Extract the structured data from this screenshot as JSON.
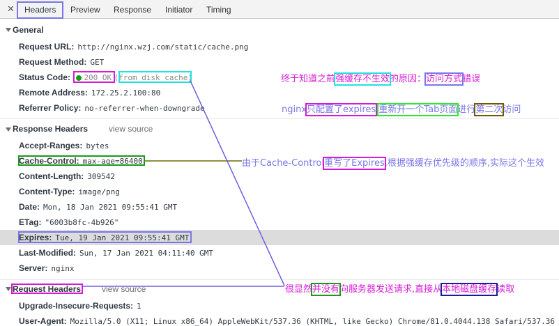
{
  "tabs": {
    "close_glyph": "✕",
    "items": [
      "Headers",
      "Preview",
      "Response",
      "Initiator",
      "Timing"
    ],
    "active": "Headers"
  },
  "general": {
    "title": "General",
    "request_url_key": "Request URL:",
    "request_url": "http://nginx.wzj.com/static/cache.png",
    "request_method_key": "Request Method:",
    "request_method": "GET",
    "status_code_key": "Status Code:",
    "status_code": "200 OK",
    "status_note_open": "(",
    "status_note": "from disk cache",
    "status_note_close": ")",
    "remote_address_key": "Remote Address:",
    "remote_address": "172.25.2.100:80",
    "referrer_policy_key": "Referrer Policy:",
    "referrer_policy": "no-referrer-when-downgrade"
  },
  "response_headers": {
    "title": "Response Headers",
    "view_source": "view source",
    "rows": [
      {
        "key": "Accept-Ranges:",
        "value": "bytes"
      },
      {
        "key": "Cache-Control:",
        "value": "max-age=86400"
      },
      {
        "key": "Content-Length:",
        "value": "309542"
      },
      {
        "key": "Content-Type:",
        "value": "image/png"
      },
      {
        "key": "Date:",
        "value": "Mon, 18 Jan 2021 09:55:41 GMT"
      },
      {
        "key": "ETag:",
        "value": "\"6003b8fc-4b926\""
      },
      {
        "key": "Expires:",
        "value": "Tue, 19 Jan 2021 09:55:41 GMT"
      },
      {
        "key": "Last-Modified:",
        "value": "Sun, 17 Jan 2021 04:11:40 GMT"
      },
      {
        "key": "Server:",
        "value": "nginx"
      }
    ]
  },
  "request_headers": {
    "title": "Request Headers",
    "view_source": "view source",
    "rows": [
      {
        "key": "Upgrade-Insecure-Requests:",
        "value": "1"
      },
      {
        "key": "User-Agent:",
        "value": "Mozilla/5.0 (X11; Linux x86_64) AppleWebKit/537.36 (KHTML, like Gecko) Chrome/81.0.4044.138 Safari/537.36"
      }
    ]
  },
  "annotations": {
    "note1": {
      "a": "终于知道之前",
      "b": "强缓存不生效",
      "c": "的原因：",
      "d": "访问方式",
      "e": "错误"
    },
    "note2": {
      "a": "nginx",
      "b": "只配置了expires",
      "c": ",",
      "d": "重新开一个Tab页面",
      "e": "进行",
      "f": "第二次",
      "g": "访问"
    },
    "note3": {
      "a": "由于Cache-Control",
      "b": "重写了Expires",
      "c": ",根据强缓存优先级的顺序,实际这个生效"
    },
    "note4": {
      "a": "很显然",
      "b": "并没有",
      "c": "向服务器发送请求,直接从",
      "d": "本地磁盘缓存",
      "e": "读取"
    }
  },
  "colors": {
    "magenta": "#d61ad6",
    "blue_violet": "#7a76e8",
    "cyan": "#22e0e0",
    "green": "#1a9a1a",
    "bright_green": "#2ee82e",
    "olive": "#6b5a00",
    "navy": "#1a1a9a"
  }
}
